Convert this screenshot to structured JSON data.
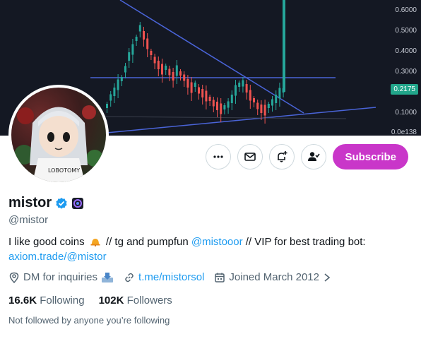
{
  "banner": {
    "price_ticks": [
      "0.6000",
      "0.5000",
      "0.4000",
      "0.3000",
      "0.1000",
      "0.0e138"
    ],
    "current_price": "0.2175"
  },
  "actions": {
    "subscribe_label": "Subscribe"
  },
  "profile": {
    "name": "mistor",
    "handle": "@mistor",
    "bio_pre": "I like good coins",
    "bio_mid": "// tg and pumpfun",
    "bio_mention": "@mistooor",
    "bio_post": "// VIP for best trading bot:",
    "bio_link": "axiom.trade/@mistor",
    "location": "DM for inquiries",
    "website": "t.me/mistorsol",
    "joined": "Joined March 2012",
    "following_count": "16.6K",
    "following_label": "Following",
    "followers_count": "102K",
    "followers_label": "Followers",
    "not_followed": "Not followed by anyone you’re following"
  },
  "colors": {
    "accent": "#c936c9",
    "link": "#1d9bf0",
    "verified": "#1d9bf0",
    "banner_bg": "#141823"
  }
}
